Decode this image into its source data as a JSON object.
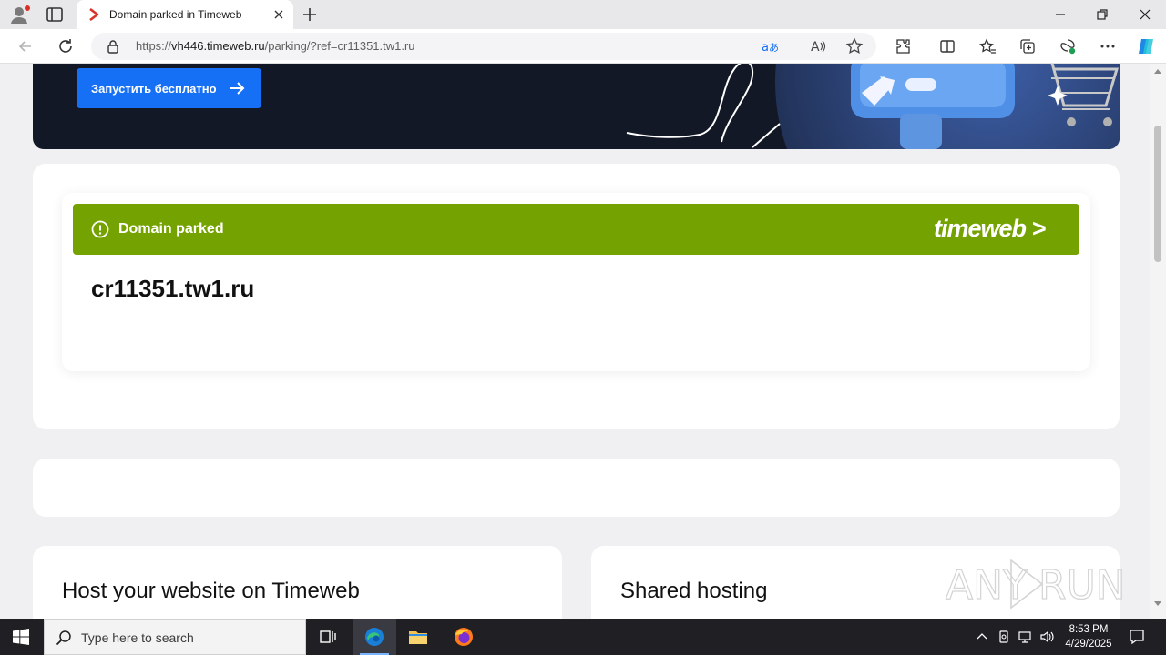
{
  "browser": {
    "tab_title": "Domain parked in Timeweb",
    "url_host": "vh446.timeweb.ru",
    "url_prefix": "https://",
    "url_path": "/parking/?ref=cr11351.tw1.ru",
    "accent_color": "#1670f6"
  },
  "banner": {
    "cta_label": "Запустить бесплатно"
  },
  "parked": {
    "status_label": "Domain parked",
    "bar_color": "#74a200",
    "brand_logo": "timeweb >",
    "domain": "cr11351.tw1.ru"
  },
  "cards": {
    "host_title": "Host your website on Timeweb",
    "shared_title": "Shared hosting"
  },
  "taskbar": {
    "search_placeholder": "Type here to search",
    "time": "8:53 PM",
    "date": "4/29/2025"
  }
}
